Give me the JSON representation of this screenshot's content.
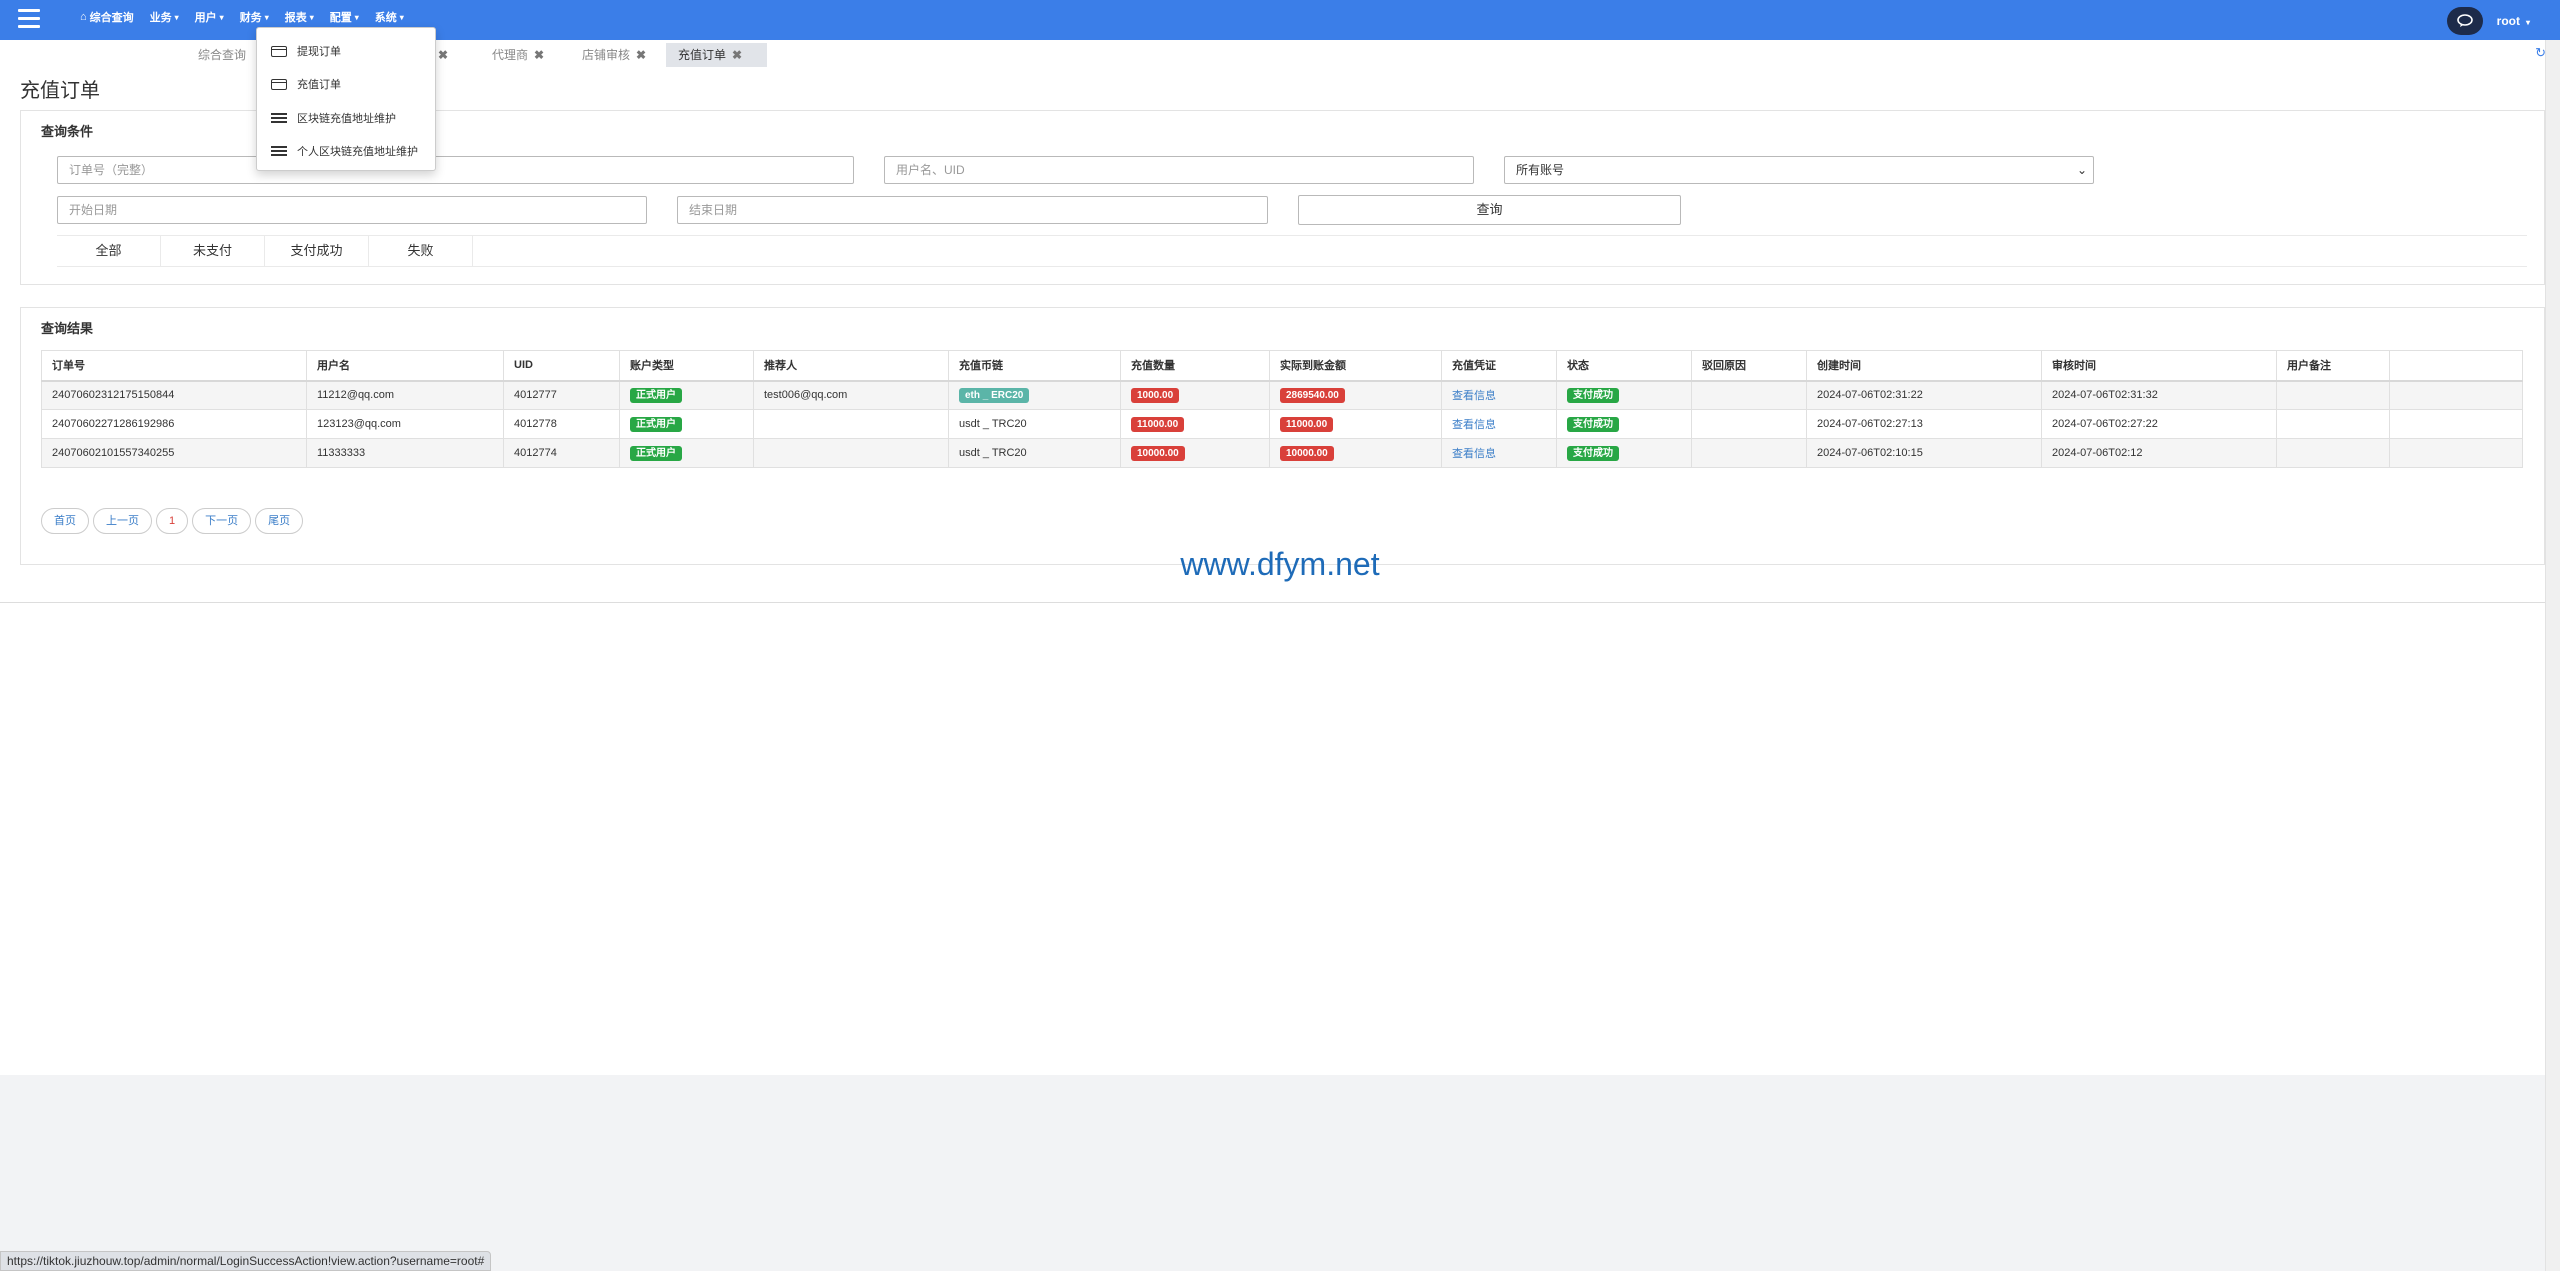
{
  "navbar": {
    "items": [
      {
        "label": "综合查询",
        "has_caret": false
      },
      {
        "label": "业务"
      },
      {
        "label": "用户"
      },
      {
        "label": "财务"
      },
      {
        "label": "报表"
      },
      {
        "label": "配置"
      },
      {
        "label": "系统"
      }
    ],
    "user": "root",
    "caret": "▾"
  },
  "tabs": [
    {
      "label": "综合查询",
      "closable": false
    },
    {
      "label": "代理商",
      "closable": true
    },
    {
      "label": "店铺审核",
      "closable": true
    },
    {
      "label": "充值订单",
      "closable": true,
      "active": true
    }
  ],
  "page_title": "充值订单",
  "search": {
    "title": "查询条件",
    "order_placeholder": "订单号（完整）",
    "user_placeholder": "用户名、UID",
    "account_select_value": "所有账号",
    "start_placeholder": "开始日期",
    "end_placeholder": "结束日期",
    "query_button": "查询",
    "status_tabs": [
      "全部",
      "未支付",
      "支付成功",
      "失败"
    ]
  },
  "results": {
    "title": "查询结果",
    "columns": [
      "订单号",
      "用户名",
      "UID",
      "账户类型",
      "推荐人",
      "充值币链",
      "充值数量",
      "实际到账金额",
      "充值凭证",
      "状态",
      "驳回原因",
      "创建时间",
      "审核时间",
      "用户备注",
      ""
    ],
    "rows": [
      {
        "order_no": "24070602312175150844",
        "username": "11212@qq.com",
        "uid": "4012777",
        "account_type": "正式用户",
        "referrer": "test006@qq.com",
        "chain": "eth _ ERC20",
        "chain_badge": true,
        "amount": "1000.00",
        "actual": "2869540.00",
        "voucher": "查看信息",
        "status": "支付成功",
        "reject_reason": "",
        "created": "2024-07-06T02:31:22",
        "reviewed": "2024-07-06T02:31:32",
        "remark": ""
      },
      {
        "order_no": "24070602271286192986",
        "username": "123123@qq.com",
        "uid": "4012778",
        "account_type": "正式用户",
        "referrer": "",
        "chain": "usdt _ TRC20",
        "chain_badge": false,
        "amount": "11000.00",
        "actual": "11000.00",
        "voucher": "查看信息",
        "status": "支付成功",
        "reject_reason": "",
        "created": "2024-07-06T02:27:13",
        "reviewed": "2024-07-06T02:27:22",
        "remark": ""
      },
      {
        "order_no": "24070602101557340255",
        "username": "11333333",
        "uid": "4012774",
        "account_type": "正式用户",
        "referrer": "",
        "chain": "usdt _ TRC20",
        "chain_badge": false,
        "amount": "10000.00",
        "actual": "10000.00",
        "voucher": "查看信息",
        "status": "支付成功",
        "reject_reason": "",
        "created": "2024-07-06T02:10:15",
        "reviewed": "2024-07-06T02:12",
        "remark": ""
      }
    ]
  },
  "pagination": {
    "first": "首页",
    "prev": "上一页",
    "current": "1",
    "next": "下一页",
    "last": "尾页"
  },
  "watermark": "www.dfym.net",
  "dropdown_menu": {
    "items": [
      {
        "label": "提现订单",
        "icon": "card-icon"
      },
      {
        "label": "充值订单",
        "icon": "card-icon"
      },
      {
        "label": "区块链充值地址维护",
        "icon": "list-icon"
      },
      {
        "label": "个人区块链充值地址维护",
        "icon": "list-icon"
      }
    ]
  },
  "status_bar_url": "https://tiktok.jiuzhouw.top/admin/normal/LoginSuccessAction!view.action?username=root#",
  "colors": {
    "nav": "#3b7ee8",
    "success": "#28a745",
    "danger": "#d9403a",
    "teal": "#5bb5a8",
    "link": "#3b7ec8"
  }
}
